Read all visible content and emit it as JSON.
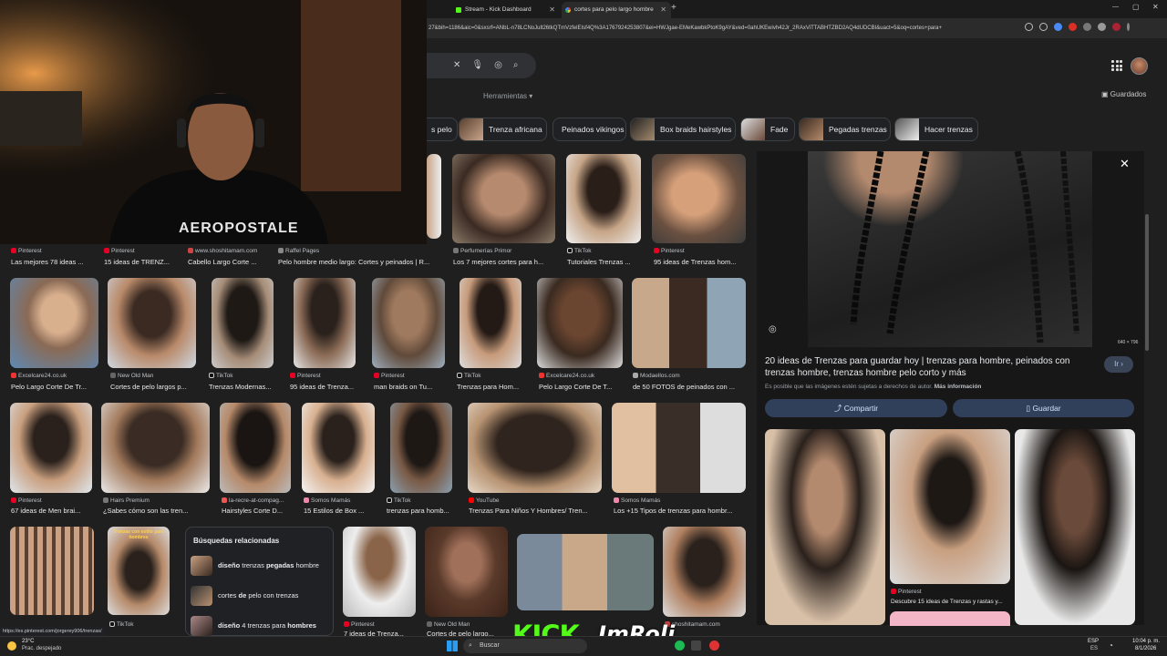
{
  "browser": {
    "tabs": [
      {
        "label": "Stream - Kick Dashboard",
        "icon": "kick-icon",
        "color": "#53fc18"
      },
      {
        "label": "cortes para pelo largo hombre",
        "icon": "google-icon",
        "color": "#4285f4"
      }
    ],
    "new_tab": "+",
    "window_controls": [
      "—",
      "▢",
      "✕"
    ],
    "url": "27&bih=1186&aic=0&sxsrf=ANbL-n78LCNoJult26tkQTmVzfelEIsf4Q%3A1767924253807&ei=HWJgae-EMeKawbkPtoK9gAY&ved=0ahUKEwivh42Jr_2RAxViTTABHTZBD2AQ4dUDCBI&uact=5&oq=cortes+para+"
  },
  "google": {
    "tools_label": "Herramientas",
    "saved_label": "Guardados",
    "chips": [
      {
        "label": "s pelo"
      },
      {
        "label": "Trenza africana"
      },
      {
        "label": "Peinados vikingos"
      },
      {
        "label": "Box braids hairstyles"
      },
      {
        "label": "Fade"
      },
      {
        "label": "Pegadas trenzas"
      },
      {
        "label": "Hacer trenzas"
      }
    ],
    "row1": [
      {
        "source": "Pinterest",
        "title": "Las mejores 78 ideas ..."
      },
      {
        "source": "Pinterest",
        "title": "15 ideas de TRENZ..."
      },
      {
        "source": "www.shoshitamam.com",
        "title": "Cabello Largo Corte ..."
      },
      {
        "source": "Raffel Pages",
        "title": "Pelo hombre medio largo: Cortes y peinados | R..."
      },
      {
        "source": "Perfumerías Primor",
        "title": "Los 7 mejores cortes para h..."
      },
      {
        "source": "TikTok",
        "title": "Tutoriales Trenzas ..."
      },
      {
        "source": "Pinterest",
        "title": "95 ideas de Trenzas hom..."
      }
    ],
    "row2": [
      {
        "source": "Excelcare24.co.uk",
        "title": "Pelo Largo Corte De Tr..."
      },
      {
        "source": "New Old Man",
        "title": "Cortes de pelo largos p..."
      },
      {
        "source": "TikTok",
        "title": "Trenzas Modernas..."
      },
      {
        "source": "Pinterest",
        "title": "95 ideas de Trenza..."
      },
      {
        "source": "Pinterest",
        "title": "man braids on Tu..."
      },
      {
        "source": "TikTok",
        "title": "Trenzas para Hom..."
      },
      {
        "source": "Excelcare24.co.uk",
        "title": "Pelo Largo Corte De T..."
      },
      {
        "source": "Modaellos.com",
        "title": "de 50 FOTOS de peinados con ..."
      }
    ],
    "row3": [
      {
        "source": "Pinterest",
        "title": "67 ideas de Men brai..."
      },
      {
        "source": "Hairs Premium",
        "title": "¿Sabes cómo son las tren..."
      },
      {
        "source": "la-recre-at-compag...",
        "title": "Hairstyles Corte D..."
      },
      {
        "source": "Somos Mamás",
        "title": "15 Estilos de Box ..."
      },
      {
        "source": "TikTok",
        "title": "trenzas para homb..."
      },
      {
        "source": "YouTube",
        "title": "Trenzas Para Niños Y Hombres/ Tren..."
      },
      {
        "source": "Somos Mamás",
        "title": "Los +15 Tipos de trenzas para hombr..."
      }
    ],
    "row4": [
      {
        "source": "TikTok"
      },
      {
        "source": "Pinterest",
        "title": "7 ideas de Trenza..."
      },
      {
        "source": "New Old Man",
        "title": "Cortes de pelo largo..."
      },
      {
        "source": "shoshitamam.com"
      }
    ],
    "related": {
      "heading": "Búsquedas relacionadas",
      "items": [
        {
          "pre": "diseño",
          "mid": " trenzas ",
          "bold": "pegadas",
          "post": " hombre"
        },
        {
          "pre": "",
          "mid": "cortes ",
          "bold": "de",
          "post": " pelo con trenzas"
        },
        {
          "pre": "diseño",
          "mid": " 4 trenzas para ",
          "bold": "hombres",
          "post": ""
        }
      ]
    },
    "thumb_caption": "Trenzas con estilo para hombres",
    "status_url": "https://es.pinterest.com/jorgerey906/trenzas/"
  },
  "panel": {
    "size": "640 × 796",
    "title": "20 ideas de Trenzas para guardar hoy | trenzas para hombre, peinados con trenzas hombre, trenzas hombre pelo corto y más",
    "notice": "Es posible que las imágenes estén sujetas a derechos de autor.",
    "more_info": "Más información",
    "go_label": "Ir",
    "share_label": "Compartir",
    "save_label": "Guardar",
    "rel_source": "Pinterest",
    "rel_title": "Descubre 15 ideas de Trenzas y rastas y..."
  },
  "taskbar": {
    "temp": "23°C",
    "weather": "Prac. despejado",
    "search": "Buscar",
    "lang": "ESP",
    "lang2": "ES",
    "time": "10:04 p. m.",
    "date": "8/1/2026"
  },
  "overlay": {
    "kick": "KICK",
    "name": "ImRoli",
    "shirt": "AEROPOSTALE"
  },
  "colors": {
    "kick_green": "#53fc18",
    "accent": "#8ab4f8",
    "pinterest": "#e60023"
  }
}
